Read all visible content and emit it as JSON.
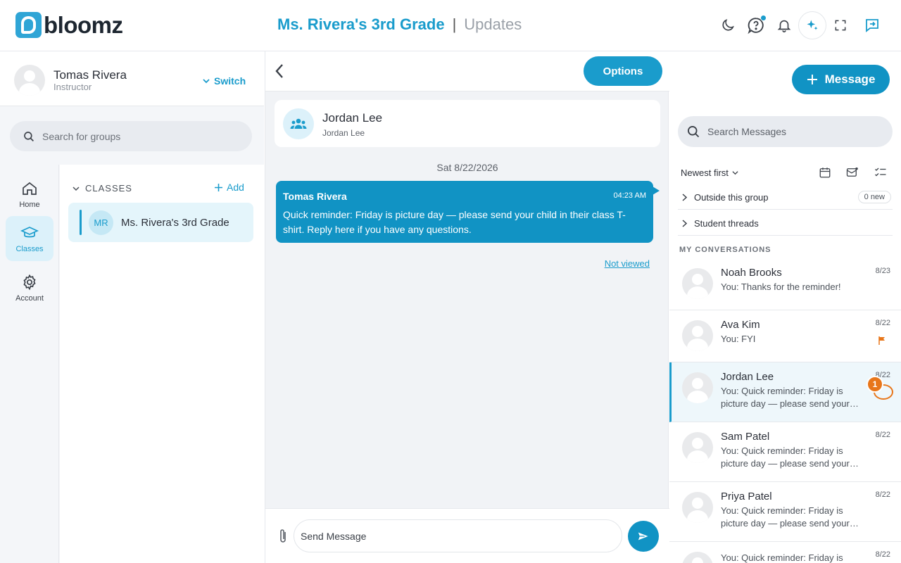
{
  "brand": {
    "name": "bloomz",
    "accent": "#1a9ccc",
    "unread_color": "#e8761a"
  },
  "header": {
    "class_name": "Ms. Rivera's 3rd Grade",
    "separator": "|",
    "section": "Updates"
  },
  "profile": {
    "name": "Tomas Rivera",
    "role": "Instructor",
    "switch_label": "Switch"
  },
  "left": {
    "search_placeholder": "Search for groups",
    "nav": [
      {
        "label": "Home",
        "icon": "home-icon"
      },
      {
        "label": "Classes",
        "icon": "graduation-cap-icon"
      },
      {
        "label": "Account",
        "icon": "gear-icon"
      }
    ],
    "classes_heading": "CLASSES",
    "add_label": "Add",
    "group": {
      "initials": "MR",
      "name": "Ms. Rivera's 3rd Grade"
    }
  },
  "thread": {
    "options_label": "Options",
    "title": "Jordan Lee",
    "subtitle": "Jordan Lee",
    "date": "Sat 8/22/2026",
    "message": {
      "from": "Tomas Rivera",
      "time": "04:23 AM",
      "text": "Quick reminder: Friday is picture day — please send your child in their class T-shirt. Reply here if you have any questions."
    },
    "status": "Not viewed",
    "composer_placeholder": "Send Message"
  },
  "right": {
    "message_button": "Message",
    "search_placeholder": "Search Messages",
    "sort_label": "Newest first",
    "outside_group": "Outside this group",
    "outside_badge": "0 new",
    "student_threads": "Student threads",
    "my_conversations": "MY CONVERSATIONS",
    "conversations": [
      {
        "name": "Noah Brooks",
        "date": "8/23",
        "preview": "You: Thanks for the reminder!"
      },
      {
        "name": "Ava Kim",
        "date": "8/22",
        "preview": "You: FYI"
      },
      {
        "name": "Jordan Lee",
        "date": "8/22",
        "preview": "You: Quick reminder: Friday is picture day — please send your child in their class T-shirt.",
        "unread": "1"
      },
      {
        "name": "Sam Patel",
        "date": "8/22",
        "preview": "You: Quick reminder: Friday is picture day — please send your child in their class T-shirt."
      },
      {
        "name": "Priya Patel",
        "date": "8/22",
        "preview": "You: Quick reminder: Friday is picture day — please send your child in their class T-shirt."
      },
      {
        "name": "",
        "date": "8/22",
        "preview": "You: Quick reminder: Friday is picture day — please send your child in their class T-shirt."
      }
    ]
  }
}
